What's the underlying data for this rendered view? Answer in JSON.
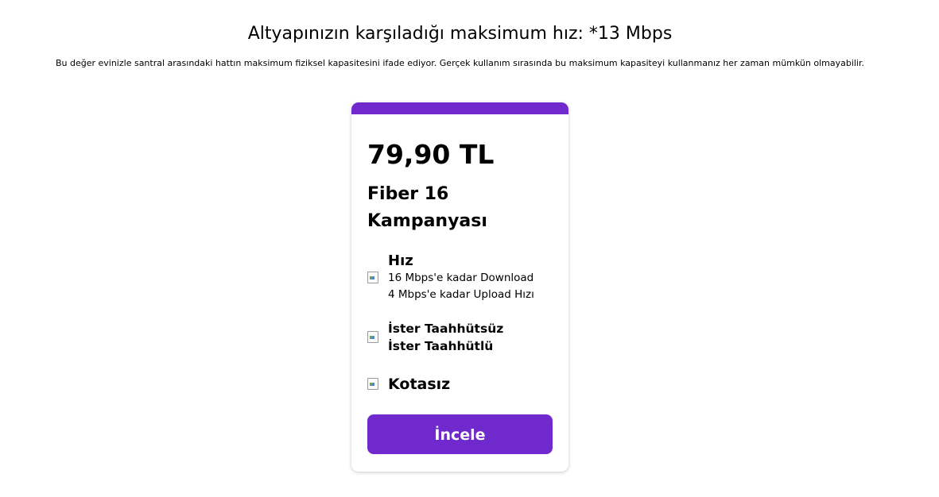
{
  "header": {
    "title": "Altyapınızın karşıladığı maksimum hız: *13 Mbps",
    "description": "Bu değer evinizle santral arasındaki hattın maksimum fiziksel kapasitesini ifade ediyor. Gerçek kullanım sırasında bu maksimum kapasiteyi kullanmanız her zaman mümkün olmayabilir."
  },
  "card": {
    "accent_color": "#7029cc",
    "price": "79,90 TL",
    "plan_name": "Fiber 16 Kampanyası",
    "features": {
      "speed": {
        "icon": "image-icon",
        "title": "Hız",
        "download": "16 Mbps'e kadar Download",
        "upload": "4 Mbps'e kadar Upload Hızı"
      },
      "commitment": {
        "icon": "image-icon",
        "line1": "İster Taahhütsüz",
        "line2": "İster Taahhütlü"
      },
      "quota": {
        "icon": "image-icon",
        "title": "Kotasız"
      }
    },
    "button_label": "İncele"
  }
}
